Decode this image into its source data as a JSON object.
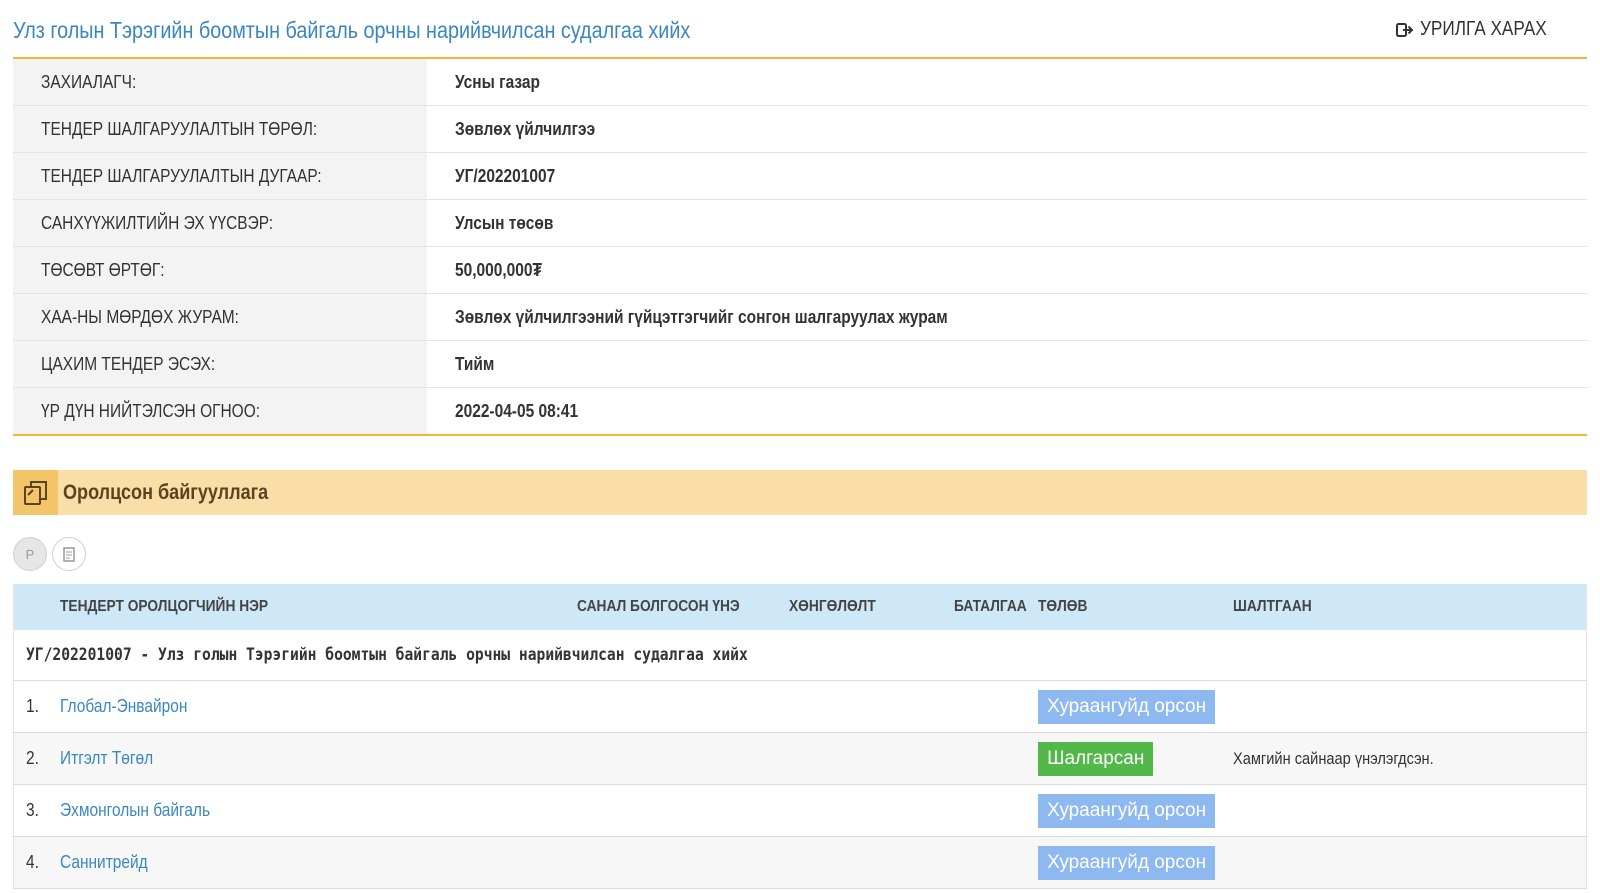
{
  "header": {
    "title": "Улз голын Тэрэгийн боомтын байгаль орчны нарийвчилсан судалгаа хийх",
    "view_link_label": "УРИЛГА ХАРАХ"
  },
  "info": [
    {
      "label": "ЗАХИАЛАГЧ:",
      "value": "Усны газар"
    },
    {
      "label": "ТЕНДЕР ШАЛГАРУУЛАЛТЫН ТӨРӨЛ:",
      "value": "Зөвлөх үйлчилгээ"
    },
    {
      "label": "ТЕНДЕР ШАЛГАРУУЛАЛТЫН ДУГААР:",
      "value": "УГ/202201007"
    },
    {
      "label": "САНХҮҮЖИЛТИЙН ЭХ ҮҮСВЭР:",
      "value": "Улсын төсөв"
    },
    {
      "label": "ТӨСӨВТ ӨРТӨГ:",
      "value": "50,000,000₮"
    },
    {
      "label": "ХАА-НЫ МӨРДӨХ ЖУРАМ:",
      "value": "Зөвлөх үйлчилгээний гүйцэтгэгчийг сонгон шалгаруулах журам"
    },
    {
      "label": "ЦАХИМ ТЕНДЕР ЭСЭХ:",
      "value": "Тийм"
    },
    {
      "label": "ҮР ДҮН НИЙТЭЛСЭН ОГНОО:",
      "value": "2022-04-05 08:41"
    }
  ],
  "section": {
    "title": "Оролцсон байгууллага",
    "icon": "copy-icon"
  },
  "tools": {
    "first_label": "Р",
    "second_icon": "document-icon"
  },
  "table": {
    "columns": [
      "ТЕНДЕРТ ОРОЛЦОГЧИЙН НЭР",
      "САНАЛ БОЛГОСОН ҮНЭ",
      "ХӨНГӨЛӨЛТ",
      "БАТАЛГАА",
      "ТӨЛӨВ",
      "ШАЛТГААН"
    ],
    "group_title": "УГ/202201007 - Улз голын Тэрэгийн боомтын байгаль орчны нарийвчилсан судалгаа хийх",
    "rows": [
      {
        "num": "1.",
        "name": "Глобал-Энвайрон",
        "status": "Хураангуйд орсон",
        "reason": ""
      },
      {
        "num": "2.",
        "name": "Итгэлт Төгөл",
        "status": "Шалгарсан",
        "reason": "Хамгийн сайнаар үнэлэгдсэн."
      },
      {
        "num": "3.",
        "name": "Эхмонголын байгаль",
        "status": "Хураангуйд орсон",
        "reason": ""
      },
      {
        "num": "4.",
        "name": "Саннитрейд",
        "status": "Хураангуйд орсон",
        "reason": ""
      }
    ]
  },
  "colors": {
    "accent": "#f0b63c",
    "link": "#3a87c0",
    "badge_shortlisted": "#8db9f0",
    "badge_selected": "#52b84a",
    "table_header": "#cfe8f7",
    "section_bar": "#f9dea8"
  }
}
